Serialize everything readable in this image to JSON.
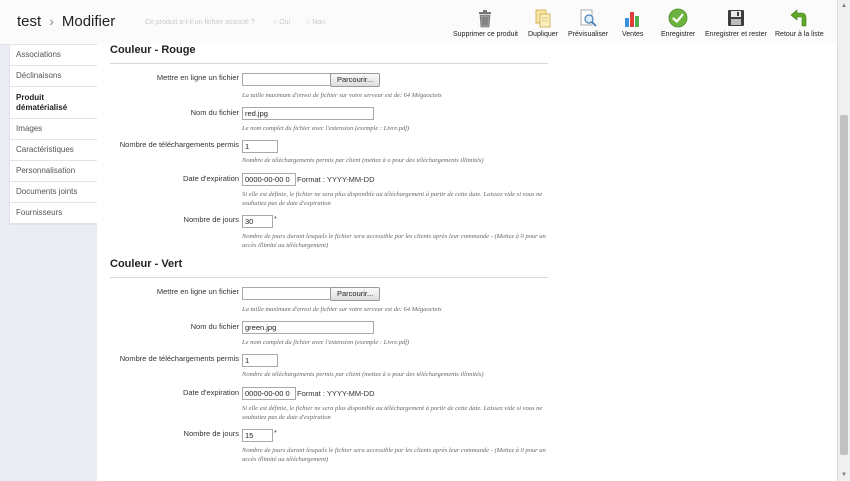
{
  "header": {
    "product_name": "test",
    "separator": "›",
    "page_title": "Modifier",
    "bg_question": "Ce produit a-t-il un fichier associé ?",
    "bg_option_yes": "Oui",
    "bg_option_no": "Non"
  },
  "toolbar": {
    "delete_label": "Supprimer ce produit",
    "duplicate_label": "Dupliquer",
    "preview_label": "Prévisualiser",
    "sales_label": "Ventes",
    "save_label": "Enregistrer",
    "save_stay_label": "Enregistrer et rester",
    "back_label": "Retour à la liste"
  },
  "sidebar": {
    "items": [
      {
        "label": "Associations"
      },
      {
        "label": "Déclinaisons"
      },
      {
        "label": "Produit dématérialisé"
      },
      {
        "label": "Images"
      },
      {
        "label": "Caractéristiques"
      },
      {
        "label": "Personnalisation"
      },
      {
        "label": "Documents joints"
      },
      {
        "label": "Fournisseurs"
      }
    ]
  },
  "sections": [
    {
      "title": "Couleur - Rouge",
      "upload_label": "Mettre en ligne un fichier",
      "browse_label": "Parcourir...",
      "upload_hint": "La taille maximum d'envoi de fichier sur votre serveur est de: 64 Mégaoctets",
      "filename_label": "Nom du fichier",
      "filename_value": "red.jpg",
      "filename_hint": "Le nom complet du fichier avec l'extension (exemple : Livre.pdf)",
      "downloads_label": "Nombre de téléchargements permis",
      "downloads_value": "1",
      "downloads_hint": "Nombre de téléchargements permis par client (mettez à o pour des téléchargements illimités)",
      "expiration_label": "Date d'expiration",
      "expiration_value": "0000-00-00 0",
      "format_label": "Format : YYYY-MM-DD",
      "expiration_hint": "Si elle est définie, le fichier ne sera plus disponible au téléchargement à partir de cette date. Laissez vide si vous ne souhaitez pas de date d'expiration",
      "days_label": "Nombre de jours",
      "days_value": "30",
      "required_mark": "*",
      "days_hint": "Nombre de jours durant lesquels le fichier sera accessible par les clients après leur commande - (Mettez à 0 pour un accès illimité au téléchargement)"
    },
    {
      "title": "Couleur - Vert",
      "upload_label": "Mettre en ligne un fichier",
      "browse_label": "Parcourir...",
      "upload_hint": "La taille maximum d'envoi de fichier sur votre serveur est de: 64 Mégaoctets",
      "filename_label": "Nom du fichier",
      "filename_value": "green.jpg",
      "filename_hint": "Le nom complet du fichier avec l'extension (exemple : Livre.pdf)",
      "downloads_label": "Nombre de téléchargements permis",
      "downloads_value": "1",
      "downloads_hint": "Nombre de téléchargements permis par client (mettez à o pour des téléchargements illimités)",
      "expiration_label": "Date d'expiration",
      "expiration_value": "0000-00-00 0",
      "format_label": "Format : YYYY-MM-DD",
      "expiration_hint": "Si elle est définie, le fichier ne sera plus disponible au téléchargement à partir de cette date. Laissez vide si vous ne souhaitez pas de date d'expiration",
      "days_label": "Nombre de jours",
      "days_value": "15",
      "required_mark": "*",
      "days_hint": "Nombre de jours durant lesquels le fichier sera accessible par les clients après leur commande - (Mettez à 0 pour un accès illimité au téléchargement)"
    }
  ],
  "icons": {
    "delete": "trash-icon",
    "duplicate": "duplicate-icon",
    "preview": "magnifier-icon",
    "sales": "bar-chart-icon",
    "save": "checkmark-icon",
    "save_stay": "floppy-disk-icon",
    "back": "back-arrow-icon"
  },
  "colors": {
    "page_bg": "#eaedf3",
    "save_green": "#6db33f",
    "back_green": "#5fa829"
  }
}
